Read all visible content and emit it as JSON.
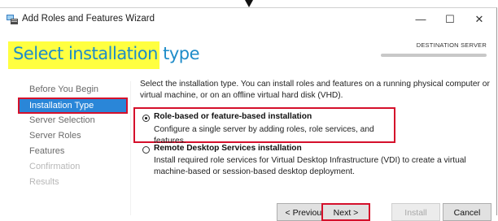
{
  "window": {
    "title": "Add Roles and Features Wizard",
    "controls": {
      "minimize": "—",
      "maximize": "☐",
      "close": "✕"
    }
  },
  "header": {
    "page_title": "Select installation type",
    "destination_label": "DESTINATION SERVER"
  },
  "nav": {
    "items": [
      {
        "label": "Before You Begin",
        "state": "normal"
      },
      {
        "label": "Installation Type",
        "state": "selected"
      },
      {
        "label": "Server Selection",
        "state": "normal"
      },
      {
        "label": "Server Roles",
        "state": "normal"
      },
      {
        "label": "Features",
        "state": "normal"
      },
      {
        "label": "Confirmation",
        "state": "disabled"
      },
      {
        "label": "Results",
        "state": "disabled"
      }
    ]
  },
  "content": {
    "intro": "Select the installation type. You can install roles and features on a running physical computer or virtual machine, or on an offline virtual hard disk (VHD).",
    "options": [
      {
        "title": "Role-based or feature-based installation",
        "description": "Configure a single server by adding roles, role services, and features.",
        "selected": true
      },
      {
        "title": "Remote Desktop Services installation",
        "description": "Install required role services for Virtual Desktop Infrastructure (VDI) to create a virtual machine-based or session-based desktop deployment.",
        "selected": false
      }
    ]
  },
  "footer": {
    "previous": "< Previous",
    "next": "Next >",
    "install": "Install",
    "cancel": "Cancel"
  },
  "colors": {
    "accent_blue": "#2a86d8",
    "title_blue": "#1e8cc9",
    "highlight_yellow": "#ffff40",
    "annotation_red": "#d5102b"
  }
}
